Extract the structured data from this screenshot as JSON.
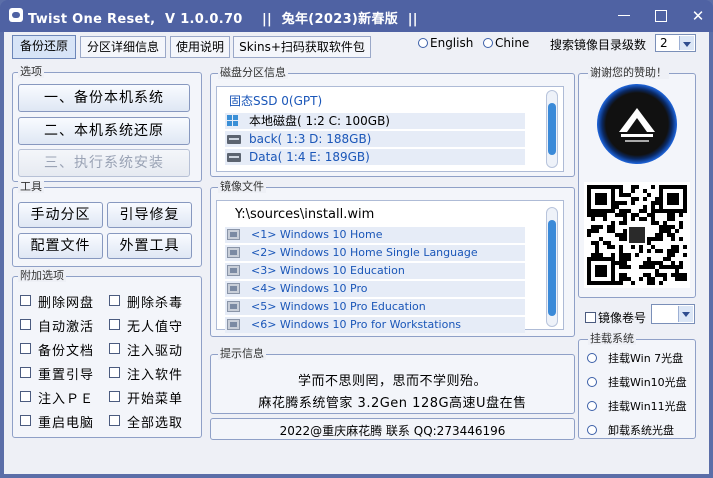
{
  "window": {
    "title": "Twist One Reset,  V 1.0.0.70    ||  兔年(2023)新春版  ||",
    "controls": [
      "minimize-icon",
      "maximize-icon",
      "close-icon"
    ]
  },
  "tabs": [
    {
      "label": "备份还原",
      "active": true
    },
    {
      "label": "分区详细信息",
      "active": false
    },
    {
      "label": "使用说明",
      "active": false
    },
    {
      "label": "Skins+扫码获取软件包",
      "active": false
    }
  ],
  "language": {
    "options": [
      "English",
      "Chine"
    ]
  },
  "search_depth": {
    "label": "搜索镜像目录级数",
    "value": "2"
  },
  "options_group": {
    "title": "选项",
    "buttons": [
      "一、备份本机系统",
      "二、本机系统还原",
      "三、执行系统安装"
    ]
  },
  "tools_group": {
    "title": "工具",
    "buttons": [
      "手动分区",
      "引导修复",
      "配置文件",
      "外置工具"
    ]
  },
  "extra_group": {
    "title": "附加选项",
    "checkboxes": [
      "删除网盘",
      "删除杀毒",
      "自动激活",
      "无人值守",
      "备份文档",
      "注入驱动",
      "重置引导",
      "注入软件",
      "注入ＰＥ",
      "开始菜单",
      "重启电脑",
      "全部选取"
    ]
  },
  "disk_group": {
    "title": "磁盘分区信息",
    "header": "固态SSD 0(GPT)",
    "partitions": [
      "本地磁盘( 1:2 C: 100GB)",
      "back( 1:3 D: 188GB)",
      "Data( 1:4 E: 189GB)"
    ]
  },
  "image_group": {
    "title": "镜像文件",
    "path": "Y:\\sources\\install.wim",
    "editions": [
      "<1> Windows 10 Home",
      "<2> Windows 10 Home Single Language",
      "<3> Windows 10 Education",
      "<4> Windows 10 Pro",
      "<5> Windows 10 Pro Education",
      "<6> Windows 10 Pro for Workstations"
    ]
  },
  "info_group": {
    "title": "提示信息",
    "line1": "学而不思则罔，思而不学则殆。",
    "line2": "麻花腾系统管家 3.2Gen 128G高速U盘在售"
  },
  "footer": "2022@重庆麻花腾 联系 QQ:273446196",
  "donate_group": {
    "title": "谢谢您的赞助！"
  },
  "volume": {
    "label": "镜像卷号",
    "value": ""
  },
  "mount_group": {
    "title": "挂载系统",
    "options": [
      "挂载Win  7光盘",
      "挂载Win10光盘",
      "挂载Win11光盘",
      "卸载系统光盘"
    ]
  },
  "colors": {
    "accent": "#4f62a3",
    "scroll_thumb": "#3b8ad8",
    "link_text": "#1a56b8"
  }
}
